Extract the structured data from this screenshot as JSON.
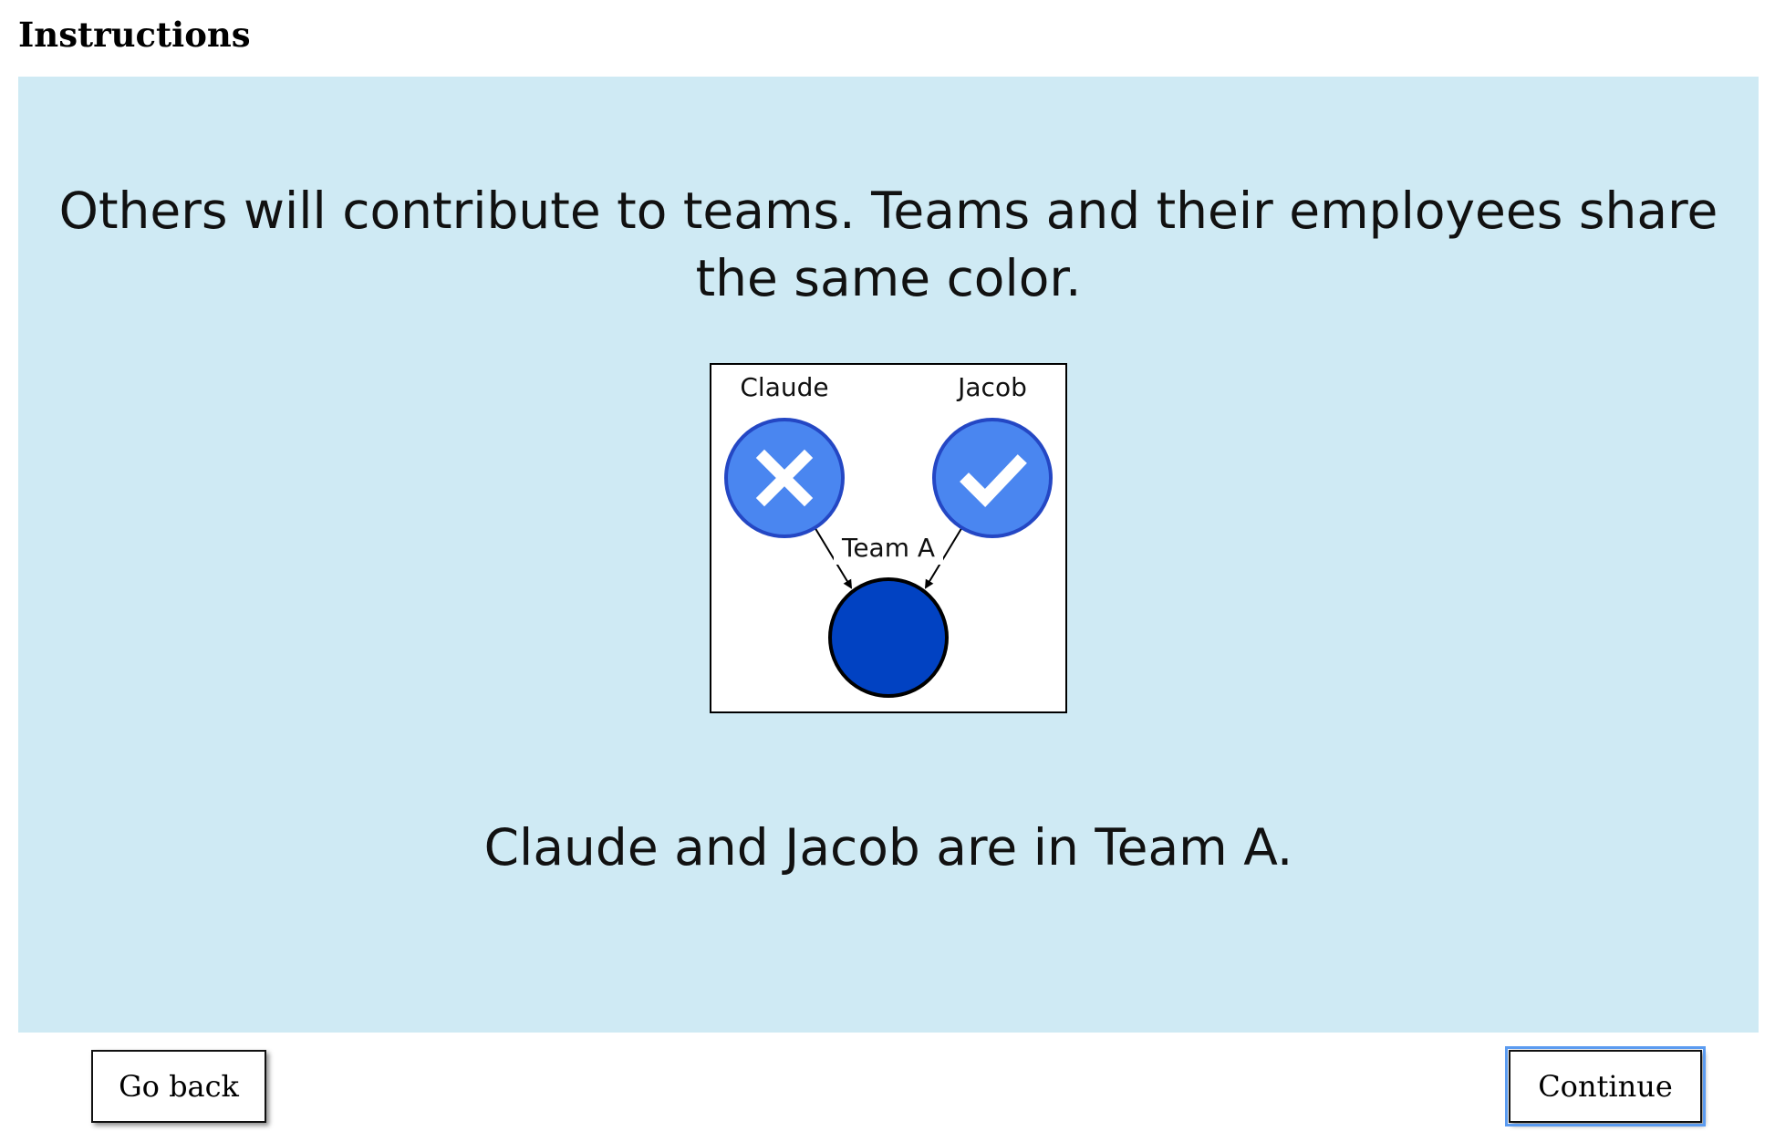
{
  "page": {
    "title": "Instructions"
  },
  "instruction": {
    "lead_text": "Others will contribute to teams. Teams and their employees share the same color.",
    "caption_text": "Claude and Jacob are in Team A."
  },
  "figure": {
    "employees": [
      {
        "name": "Claude",
        "status_icon": "x-icon"
      },
      {
        "name": "Jacob",
        "status_icon": "checkmark-icon"
      }
    ],
    "team_label": "Team A",
    "colors": {
      "employee_fill": "#4a86f0",
      "employee_stroke": "#2447c4",
      "team_fill": "#0142c2",
      "team_stroke": "#000000"
    }
  },
  "buttons": {
    "back_label": "Go back",
    "continue_label": "Continue"
  }
}
